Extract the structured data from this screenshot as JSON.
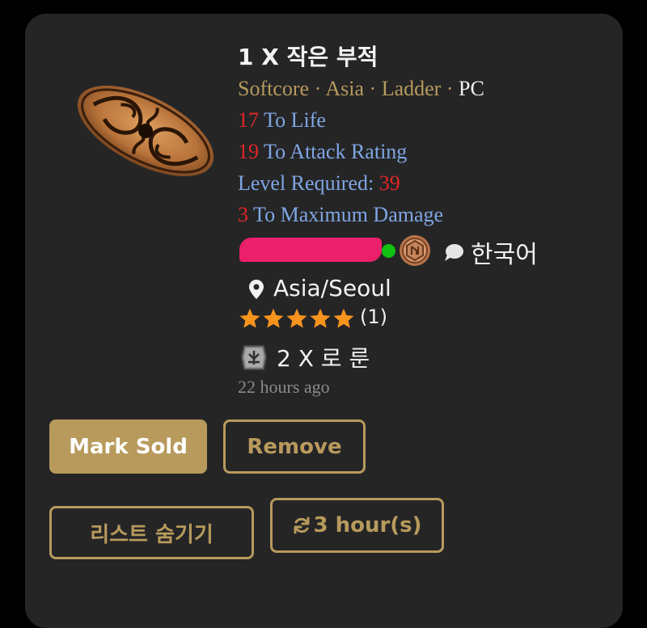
{
  "listing": {
    "title": "1 X 작은 부적",
    "tags": {
      "mode": "Softcore",
      "region": "Asia",
      "season": "Ladder",
      "platform": "PC",
      "separator": "·"
    },
    "properties": [
      {
        "value": "17",
        "label": "To Life"
      },
      {
        "value": "19",
        "label": "To Attack Rating"
      },
      {
        "label": "Level Required:",
        "value": "39"
      },
      {
        "value": "3",
        "label": "To Maximum Damage"
      }
    ],
    "seller": {
      "online_color": "#12c112",
      "language": "한국어",
      "location": "Asia/Seoul",
      "rating_stars": 5,
      "rating_count": "(1)"
    },
    "price": "2 X 로 룬",
    "posted": "22 hours ago"
  },
  "actions": {
    "mark_sold": "Mark Sold",
    "remove": "Remove",
    "hide_listing": "리스트 숨기기",
    "refresh": "3 hour(s)"
  },
  "colors": {
    "background": "#000000",
    "card": "#252526",
    "accent_gold": "#b79a5c",
    "property_blue": "#7fa6e3",
    "value_red": "#e02626",
    "redaction": "#ec1f6b",
    "star": "#f7941d"
  },
  "icons": {
    "item": "small-charm-icon",
    "badge": "bronze-rank-badge-icon",
    "language": "chat-bubble-icon",
    "location": "map-pin-icon",
    "price": "rune-icon",
    "refresh": "refresh-icon"
  }
}
